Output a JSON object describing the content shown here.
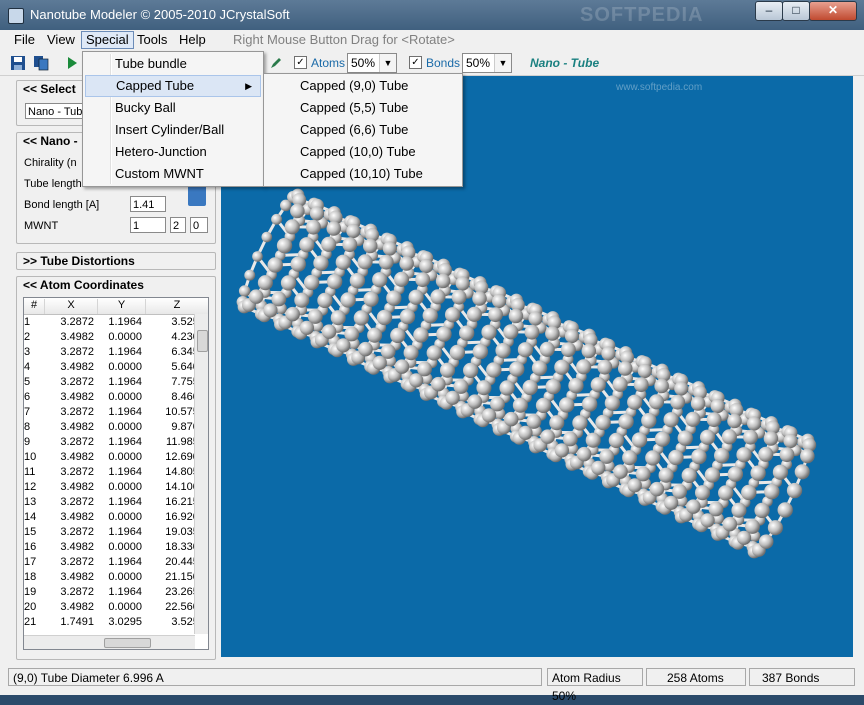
{
  "window": {
    "title": "Nanotube Modeler © 2005-2010  JCrystalSoft",
    "watermark": "SOFTPEDIA",
    "min_glyph": "–",
    "max_glyph": "□",
    "close_glyph": "✕"
  },
  "menubar": {
    "items": [
      "File",
      "View",
      "Special",
      "Tools",
      "Help"
    ],
    "hint": "Right Mouse Button Drag for <Rotate>"
  },
  "toolbar": {
    "atoms_label": "Atoms",
    "atoms_value": "50%",
    "bonds_label": "Bonds",
    "bonds_value": "50%",
    "check_glyph": "✓",
    "arrow_glyph": "▼",
    "model_title": "Nano - Tube"
  },
  "special_menu": {
    "items": [
      "Tube bundle",
      "Capped Tube",
      "Bucky Ball",
      "Insert Cylinder/Ball",
      "Hetero-Junction",
      "Custom MWNT"
    ],
    "highlighted": "Capped Tube",
    "submenu_arrow": "▶"
  },
  "capped_submenu": {
    "items": [
      "Capped (9,0) Tube",
      "Capped (5,5) Tube",
      "Capped (6,6) Tube",
      "Capped (10,0) Tube",
      "Capped (10,10) Tube"
    ]
  },
  "left_panel": {
    "select_header": "<<  Select",
    "select_value": "Nano - Tub",
    "nano_header": "<<  Nano -",
    "chirality_label": "Chirality  (n",
    "tube_length_label": "Tube length",
    "bond_length_label": "Bond length [A]",
    "bond_length_value": "1.41",
    "mwnt_label": "MWNT",
    "mwnt_values": [
      "1",
      "2",
      "0"
    ],
    "distortions_header": ">>  Tube Distortions",
    "coords_header": "<<  Atom Coordinates"
  },
  "atom_table": {
    "columns": [
      "#",
      "X",
      "Y",
      "Z"
    ],
    "rows": [
      [
        "1",
        "3.2872",
        "1.1964",
        "3.5250"
      ],
      [
        "2",
        "3.4982",
        "0.0000",
        "4.2300"
      ],
      [
        "3",
        "3.2872",
        "1.1964",
        "6.3450"
      ],
      [
        "4",
        "3.4982",
        "0.0000",
        "5.6400"
      ],
      [
        "5",
        "3.2872",
        "1.1964",
        "7.7550"
      ],
      [
        "6",
        "3.4982",
        "0.0000",
        "8.4600"
      ],
      [
        "7",
        "3.2872",
        "1.1964",
        "10.5750"
      ],
      [
        "8",
        "3.4982",
        "0.0000",
        "9.8700"
      ],
      [
        "9",
        "3.2872",
        "1.1964",
        "11.9850"
      ],
      [
        "10",
        "3.4982",
        "0.0000",
        "12.6900"
      ],
      [
        "11",
        "3.2872",
        "1.1964",
        "14.8050"
      ],
      [
        "12",
        "3.4982",
        "0.0000",
        "14.1000"
      ],
      [
        "13",
        "3.2872",
        "1.1964",
        "16.2150"
      ],
      [
        "14",
        "3.4982",
        "0.0000",
        "16.9200"
      ],
      [
        "15",
        "3.2872",
        "1.1964",
        "19.0350"
      ],
      [
        "16",
        "3.4982",
        "0.0000",
        "18.3300"
      ],
      [
        "17",
        "3.2872",
        "1.1964",
        "20.4450"
      ],
      [
        "18",
        "3.4982",
        "0.0000",
        "21.1500"
      ],
      [
        "19",
        "3.2872",
        "1.1964",
        "23.2650"
      ],
      [
        "20",
        "3.4982",
        "0.0000",
        "22.5600"
      ],
      [
        "21",
        "1.7491",
        "3.0295",
        "3.5250"
      ]
    ]
  },
  "viewport": {
    "background": "#0b6aa8",
    "watermark": "www.softpedia.com"
  },
  "statusbar": {
    "diameter": "(9,0) Tube Diameter 6.996 A",
    "atom_radius": "Atom Radius 50%",
    "atoms": "258 Atoms",
    "bonds": "387 Bonds"
  }
}
